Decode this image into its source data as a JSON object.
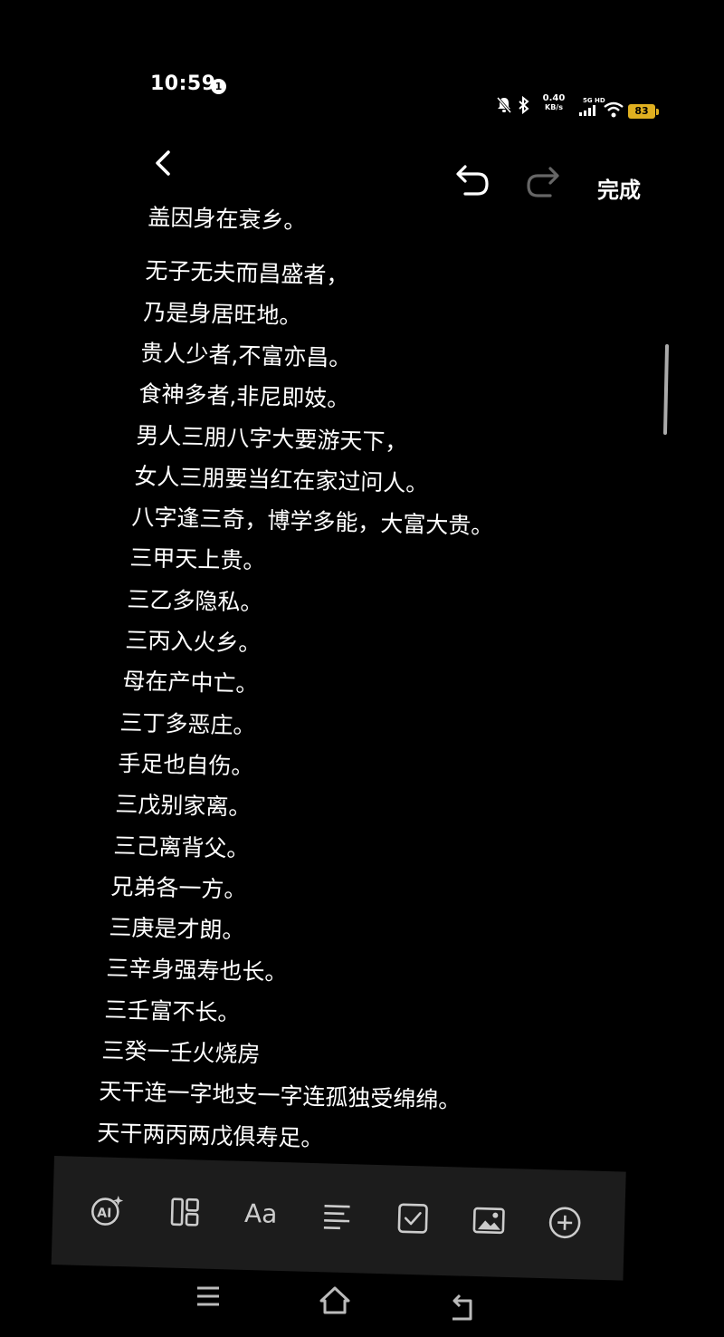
{
  "status_bar": {
    "time": "10:59",
    "notification_count": "1",
    "net_speed_value": "0.40",
    "net_speed_unit": "KB/s",
    "network_type_top": "5G HD",
    "battery": "83",
    "battery_color": "#e0b020"
  },
  "toolbar": {
    "done_label": "完成"
  },
  "note": {
    "lines": [
      "盖因身在衰乡。",
      "无子无夫而昌盛者，",
      "乃是身居旺地。",
      "贵人少者,不富亦昌。",
      "食神多者,非尼即妓。",
      "男人三朋八字大要游天下，",
      "女人三朋要当红在家过问人。",
      "八字逢三奇，博学多能，大富大贵。",
      "三甲天上贵。",
      "三乙多隐私。",
      "三丙入火乡。",
      "母在产中亡。",
      "三丁多恶庄。",
      "手足也自伤。",
      "三戊别家离。",
      "三己离背父。",
      "兄弟各一方。",
      "三庚是才朗。",
      "三辛身强寿也长。",
      "三壬富不长。",
      "三癸一壬火烧房",
      "天干连一字地支一字连孤独受绵绵。",
      "天干两丙两戊俱寿足。"
    ]
  },
  "bottom_toolbar": {
    "items": [
      {
        "icon": "ai-icon"
      },
      {
        "icon": "template-icon"
      },
      {
        "icon": "text-format-icon",
        "label": "Aa"
      },
      {
        "icon": "paragraph-icon"
      },
      {
        "icon": "checkbox-icon"
      },
      {
        "icon": "image-icon"
      },
      {
        "icon": "add-icon"
      }
    ]
  },
  "nav_bar": {
    "items": [
      {
        "icon": "menu-icon"
      },
      {
        "icon": "home-icon"
      },
      {
        "icon": "back-icon"
      }
    ]
  }
}
